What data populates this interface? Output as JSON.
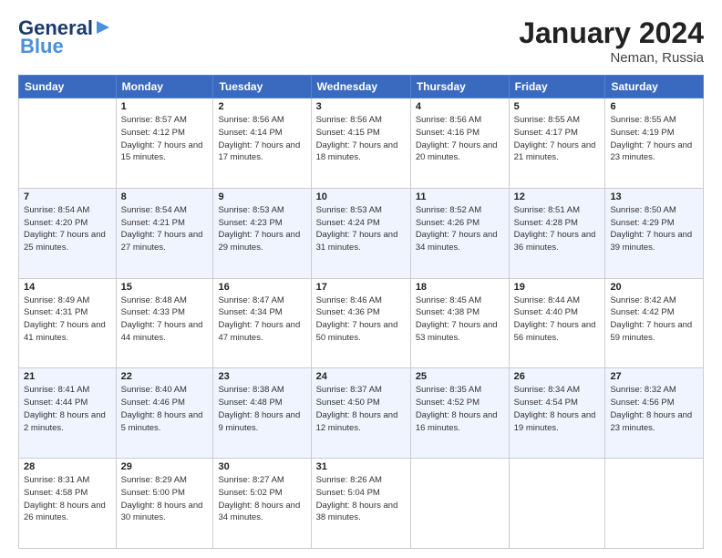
{
  "header": {
    "logo_general": "General",
    "logo_blue": "Blue",
    "month_title": "January 2024",
    "location": "Neman, Russia"
  },
  "days_of_week": [
    "Sunday",
    "Monday",
    "Tuesday",
    "Wednesday",
    "Thursday",
    "Friday",
    "Saturday"
  ],
  "weeks": [
    [
      {
        "day": "",
        "sunrise": "",
        "sunset": "",
        "daylight": ""
      },
      {
        "day": "1",
        "sunrise": "Sunrise: 8:57 AM",
        "sunset": "Sunset: 4:12 PM",
        "daylight": "Daylight: 7 hours and 15 minutes."
      },
      {
        "day": "2",
        "sunrise": "Sunrise: 8:56 AM",
        "sunset": "Sunset: 4:14 PM",
        "daylight": "Daylight: 7 hours and 17 minutes."
      },
      {
        "day": "3",
        "sunrise": "Sunrise: 8:56 AM",
        "sunset": "Sunset: 4:15 PM",
        "daylight": "Daylight: 7 hours and 18 minutes."
      },
      {
        "day": "4",
        "sunrise": "Sunrise: 8:56 AM",
        "sunset": "Sunset: 4:16 PM",
        "daylight": "Daylight: 7 hours and 20 minutes."
      },
      {
        "day": "5",
        "sunrise": "Sunrise: 8:55 AM",
        "sunset": "Sunset: 4:17 PM",
        "daylight": "Daylight: 7 hours and 21 minutes."
      },
      {
        "day": "6",
        "sunrise": "Sunrise: 8:55 AM",
        "sunset": "Sunset: 4:19 PM",
        "daylight": "Daylight: 7 hours and 23 minutes."
      }
    ],
    [
      {
        "day": "7",
        "sunrise": "Sunrise: 8:54 AM",
        "sunset": "Sunset: 4:20 PM",
        "daylight": "Daylight: 7 hours and 25 minutes."
      },
      {
        "day": "8",
        "sunrise": "Sunrise: 8:54 AM",
        "sunset": "Sunset: 4:21 PM",
        "daylight": "Daylight: 7 hours and 27 minutes."
      },
      {
        "day": "9",
        "sunrise": "Sunrise: 8:53 AM",
        "sunset": "Sunset: 4:23 PM",
        "daylight": "Daylight: 7 hours and 29 minutes."
      },
      {
        "day": "10",
        "sunrise": "Sunrise: 8:53 AM",
        "sunset": "Sunset: 4:24 PM",
        "daylight": "Daylight: 7 hours and 31 minutes."
      },
      {
        "day": "11",
        "sunrise": "Sunrise: 8:52 AM",
        "sunset": "Sunset: 4:26 PM",
        "daylight": "Daylight: 7 hours and 34 minutes."
      },
      {
        "day": "12",
        "sunrise": "Sunrise: 8:51 AM",
        "sunset": "Sunset: 4:28 PM",
        "daylight": "Daylight: 7 hours and 36 minutes."
      },
      {
        "day": "13",
        "sunrise": "Sunrise: 8:50 AM",
        "sunset": "Sunset: 4:29 PM",
        "daylight": "Daylight: 7 hours and 39 minutes."
      }
    ],
    [
      {
        "day": "14",
        "sunrise": "Sunrise: 8:49 AM",
        "sunset": "Sunset: 4:31 PM",
        "daylight": "Daylight: 7 hours and 41 minutes."
      },
      {
        "day": "15",
        "sunrise": "Sunrise: 8:48 AM",
        "sunset": "Sunset: 4:33 PM",
        "daylight": "Daylight: 7 hours and 44 minutes."
      },
      {
        "day": "16",
        "sunrise": "Sunrise: 8:47 AM",
        "sunset": "Sunset: 4:34 PM",
        "daylight": "Daylight: 7 hours and 47 minutes."
      },
      {
        "day": "17",
        "sunrise": "Sunrise: 8:46 AM",
        "sunset": "Sunset: 4:36 PM",
        "daylight": "Daylight: 7 hours and 50 minutes."
      },
      {
        "day": "18",
        "sunrise": "Sunrise: 8:45 AM",
        "sunset": "Sunset: 4:38 PM",
        "daylight": "Daylight: 7 hours and 53 minutes."
      },
      {
        "day": "19",
        "sunrise": "Sunrise: 8:44 AM",
        "sunset": "Sunset: 4:40 PM",
        "daylight": "Daylight: 7 hours and 56 minutes."
      },
      {
        "day": "20",
        "sunrise": "Sunrise: 8:42 AM",
        "sunset": "Sunset: 4:42 PM",
        "daylight": "Daylight: 7 hours and 59 minutes."
      }
    ],
    [
      {
        "day": "21",
        "sunrise": "Sunrise: 8:41 AM",
        "sunset": "Sunset: 4:44 PM",
        "daylight": "Daylight: 8 hours and 2 minutes."
      },
      {
        "day": "22",
        "sunrise": "Sunrise: 8:40 AM",
        "sunset": "Sunset: 4:46 PM",
        "daylight": "Daylight: 8 hours and 5 minutes."
      },
      {
        "day": "23",
        "sunrise": "Sunrise: 8:38 AM",
        "sunset": "Sunset: 4:48 PM",
        "daylight": "Daylight: 8 hours and 9 minutes."
      },
      {
        "day": "24",
        "sunrise": "Sunrise: 8:37 AM",
        "sunset": "Sunset: 4:50 PM",
        "daylight": "Daylight: 8 hours and 12 minutes."
      },
      {
        "day": "25",
        "sunrise": "Sunrise: 8:35 AM",
        "sunset": "Sunset: 4:52 PM",
        "daylight": "Daylight: 8 hours and 16 minutes."
      },
      {
        "day": "26",
        "sunrise": "Sunrise: 8:34 AM",
        "sunset": "Sunset: 4:54 PM",
        "daylight": "Daylight: 8 hours and 19 minutes."
      },
      {
        "day": "27",
        "sunrise": "Sunrise: 8:32 AM",
        "sunset": "Sunset: 4:56 PM",
        "daylight": "Daylight: 8 hours and 23 minutes."
      }
    ],
    [
      {
        "day": "28",
        "sunrise": "Sunrise: 8:31 AM",
        "sunset": "Sunset: 4:58 PM",
        "daylight": "Daylight: 8 hours and 26 minutes."
      },
      {
        "day": "29",
        "sunrise": "Sunrise: 8:29 AM",
        "sunset": "Sunset: 5:00 PM",
        "daylight": "Daylight: 8 hours and 30 minutes."
      },
      {
        "day": "30",
        "sunrise": "Sunrise: 8:27 AM",
        "sunset": "Sunset: 5:02 PM",
        "daylight": "Daylight: 8 hours and 34 minutes."
      },
      {
        "day": "31",
        "sunrise": "Sunrise: 8:26 AM",
        "sunset": "Sunset: 5:04 PM",
        "daylight": "Daylight: 8 hours and 38 minutes."
      },
      {
        "day": "",
        "sunrise": "",
        "sunset": "",
        "daylight": ""
      },
      {
        "day": "",
        "sunrise": "",
        "sunset": "",
        "daylight": ""
      },
      {
        "day": "",
        "sunrise": "",
        "sunset": "",
        "daylight": ""
      }
    ]
  ]
}
